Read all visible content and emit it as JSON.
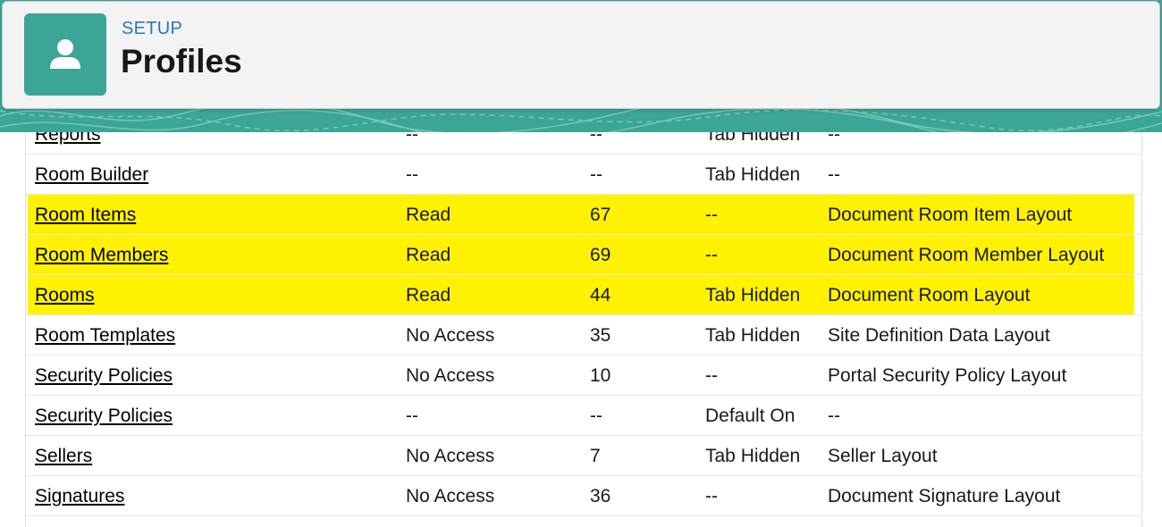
{
  "header": {
    "section": "SETUP",
    "title": "Profiles",
    "icon": "user-icon",
    "accent": "#3ba597"
  },
  "highlight_color": "#fff200",
  "rows": [
    {
      "name": "Reports",
      "access": "--",
      "count": "--",
      "tab": "Tab Hidden",
      "layout": "--",
      "highlighted": false
    },
    {
      "name": "Room Builder",
      "access": "--",
      "count": "--",
      "tab": "Tab Hidden",
      "layout": "--",
      "highlighted": false
    },
    {
      "name": "Room Items",
      "access": "Read",
      "count": "67",
      "tab": "--",
      "layout": "Document Room Item Layout",
      "highlighted": true
    },
    {
      "name": "Room Members",
      "access": "Read",
      "count": "69",
      "tab": "--",
      "layout": "Document Room Member Layout",
      "highlighted": true
    },
    {
      "name": "Rooms",
      "access": "Read",
      "count": "44",
      "tab": "Tab Hidden",
      "layout": "Document Room Layout",
      "highlighted": true
    },
    {
      "name": "Room Templates",
      "access": "No Access",
      "count": "35",
      "tab": "Tab Hidden",
      "layout": "Site Definition Data Layout",
      "highlighted": false
    },
    {
      "name": "Security Policies",
      "access": "No Access",
      "count": "10",
      "tab": "--",
      "layout": "Portal Security Policy Layout",
      "highlighted": false
    },
    {
      "name": "Security Policies",
      "access": "--",
      "count": "--",
      "tab": "Default On",
      "layout": "--",
      "highlighted": false
    },
    {
      "name": "Sellers",
      "access": "No Access",
      "count": "7",
      "tab": "Tab Hidden",
      "layout": "Seller Layout",
      "highlighted": false
    },
    {
      "name": "Signatures",
      "access": "No Access",
      "count": "36",
      "tab": "--",
      "layout": "Document Signature Layout",
      "highlighted": false
    },
    {
      "name": "",
      "access": "",
      "count": "",
      "tab": "",
      "layout": "",
      "highlighted": false
    }
  ]
}
